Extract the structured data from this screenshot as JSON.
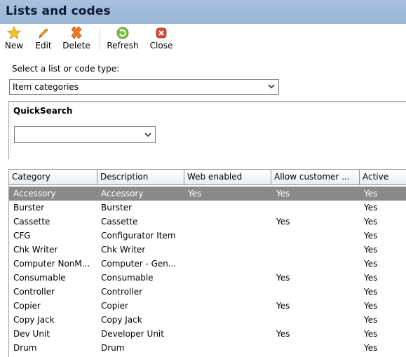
{
  "window": {
    "title": "Lists and codes"
  },
  "toolbar": {
    "buttons": [
      {
        "label": "New",
        "icon": "star-icon"
      },
      {
        "label": "Edit",
        "icon": "pencil-icon"
      },
      {
        "label": "Delete",
        "icon": "delete-x-icon"
      },
      {
        "label": "Refresh",
        "icon": "refresh-icon"
      },
      {
        "label": "Close",
        "icon": "close-icon"
      }
    ]
  },
  "list_select": {
    "label": "Select a list or code type:",
    "value": "Item categories"
  },
  "quicksearch": {
    "title": "QuickSearch",
    "value": ""
  },
  "grid": {
    "columns": [
      "Category",
      "Description",
      "Web enabled",
      "Allow customer ...",
      "Active"
    ],
    "rows": [
      [
        "Accessory",
        "Accessory",
        "Yes",
        "Yes",
        "Yes"
      ],
      [
        "Burster",
        "Burster",
        "",
        "",
        "Yes"
      ],
      [
        "Cassette",
        "Cassette",
        "",
        "Yes",
        "Yes"
      ],
      [
        "CFG",
        "Configurator Item",
        "",
        "",
        "Yes"
      ],
      [
        "Chk Writer",
        "Chk Writer",
        "",
        "",
        "Yes"
      ],
      [
        "Computer NonM...",
        "Computer - Gen...",
        "",
        "",
        "Yes"
      ],
      [
        "Consumable",
        "Consumable",
        "",
        "Yes",
        "Yes"
      ],
      [
        "Controller",
        "Controller",
        "",
        "",
        "Yes"
      ],
      [
        "Copier",
        "Copier",
        "",
        "Yes",
        "Yes"
      ],
      [
        "Copy Jack",
        "Copy Jack",
        "",
        "",
        "Yes"
      ],
      [
        "Dev Unit",
        "Developer Unit",
        "",
        "Yes",
        "Yes"
      ],
      [
        "Drum",
        "Drum",
        "",
        "",
        "Yes"
      ]
    ],
    "selected_row": 0
  },
  "colors": {
    "title_bar": "#a6bfdd",
    "selected_row": "#8a8a8a"
  }
}
